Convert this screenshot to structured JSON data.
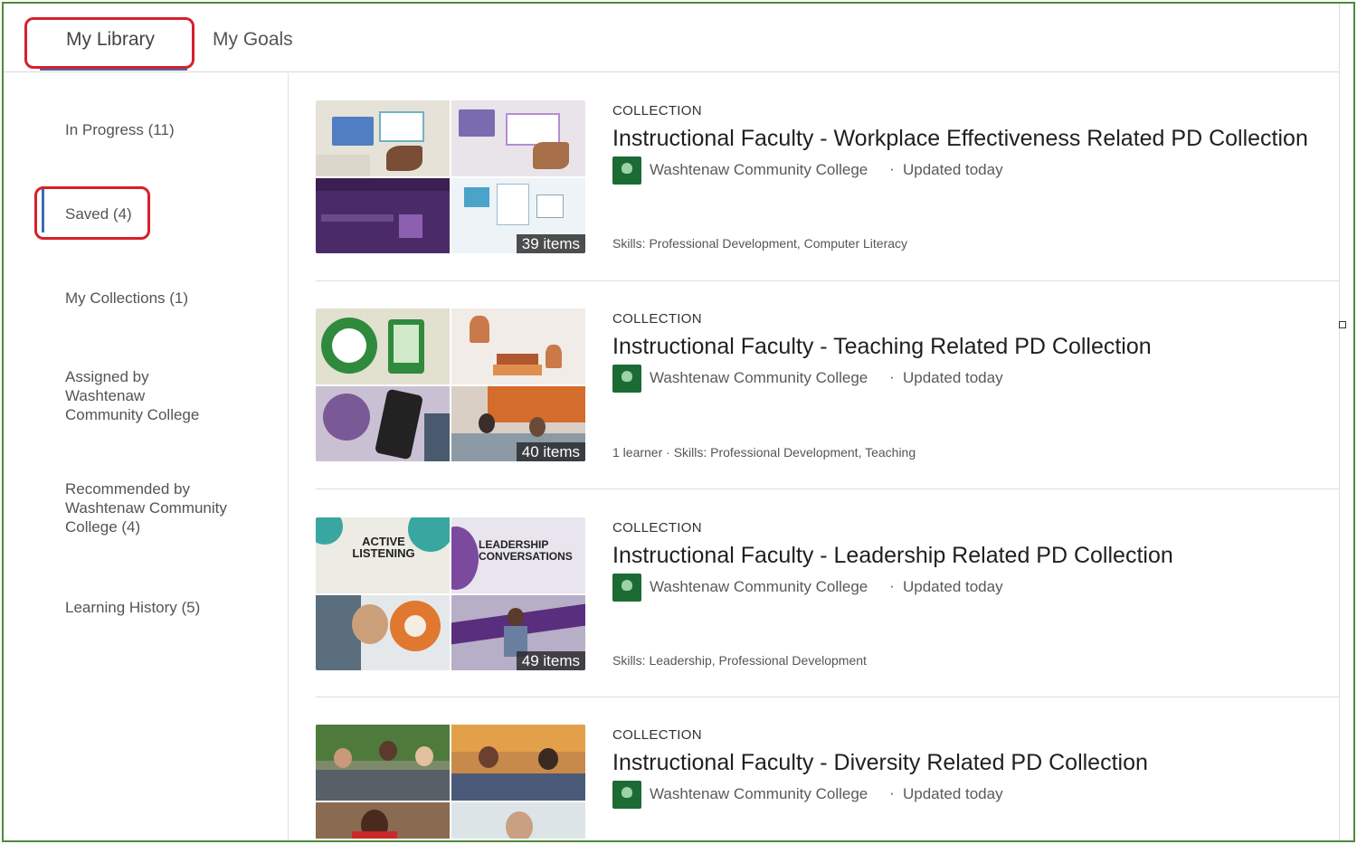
{
  "tabs": {
    "library": "My Library",
    "goals": "My Goals"
  },
  "sidebar": {
    "items": [
      {
        "label": "In Progress (11)"
      },
      {
        "label": "Saved (4)"
      },
      {
        "label": "My Collections (1)"
      },
      {
        "label": "Assigned by Washtenaw Community College"
      },
      {
        "label": "Recommended by Washtenaw Community College (4)"
      },
      {
        "label": "Learning History (5)"
      }
    ]
  },
  "colors": {
    "frame": "#4e8a3a",
    "annotation": "#d6202a",
    "accent": "#3c6cb4"
  },
  "cards": [
    {
      "type": "COLLECTION",
      "title": "Instructional Faculty - Workplace Effectiveness Related PD Collection",
      "org": "Washtenaw Community College",
      "dot": "·",
      "updated": "Updated today",
      "items": "39 items",
      "meta": "Skills: Professional Development, Computer Literacy"
    },
    {
      "type": "COLLECTION",
      "title": "Instructional Faculty - Teaching Related PD Collection",
      "org": "Washtenaw Community College",
      "dot": "·",
      "updated": "Updated today",
      "items": "40 items",
      "meta": "1 learner  ·  Skills: Professional Development, Teaching"
    },
    {
      "type": "COLLECTION",
      "title": "Instructional Faculty - Leadership Related PD Collection",
      "org": "Washtenaw Community College",
      "dot": "·",
      "updated": "Updated today",
      "items": "49 items",
      "meta": "Skills: Leadership, Professional Development"
    },
    {
      "type": "COLLECTION",
      "title": "Instructional Faculty - Diversity Related PD Collection",
      "org": "Washtenaw Community College",
      "dot": "·",
      "updated": "Updated today",
      "items": "",
      "meta": ""
    }
  ],
  "thumb_text": {
    "active_listening": "ACTIVE LISTENING",
    "leadership": "LEADERSHIP CONVERSATIONS"
  }
}
